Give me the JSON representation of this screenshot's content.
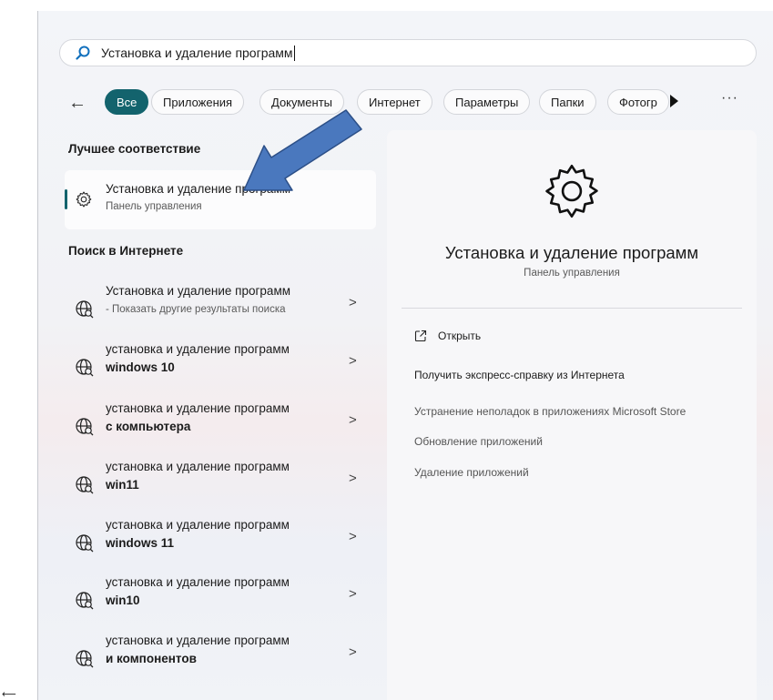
{
  "search": {
    "query": "Установка и удаление программ"
  },
  "filters": {
    "back_label": "←",
    "chips": [
      "Все",
      "Приложения",
      "Документы",
      "Интернет",
      "Параметры",
      "Папки",
      "Фотогр"
    ],
    "more_label": "···"
  },
  "best_match": {
    "heading": "Лучшее соответствие",
    "title": "Установка и удаление программ",
    "subtitle": "Панель управления"
  },
  "web": {
    "heading": "Поиск в Интернете",
    "items": [
      {
        "line1": "Установка и удаление программ",
        "line2": "- Показать другие результаты поиска"
      },
      {
        "line1": "установка и удаление программ",
        "line2": "windows 10"
      },
      {
        "line1": "установка и удаление программ",
        "line2": "с компьютера"
      },
      {
        "line1": "установка и удаление программ",
        "line2": "win11"
      },
      {
        "line1": "установка и удаление программ",
        "line2": "windows 11"
      },
      {
        "line1": "установка и удаление программ",
        "line2": "win10"
      },
      {
        "line1": "установка и удаление программ",
        "line2": "и компонентов"
      }
    ],
    "chevron": ">"
  },
  "detail": {
    "title": "Установка и удаление программ",
    "subtitle": "Панель управления",
    "open_label": "Открыть",
    "actions": [
      "Получить экспресс-справку из Интернета",
      "Устранение неполадок в приложениях Microsoft Store",
      "Обновление приложений",
      "Удаление приложений"
    ]
  },
  "colors": {
    "accent": "#13636d",
    "annotation_arrow": "#4a78be"
  },
  "icons": {
    "search": "search-icon",
    "settings": "gear-icon",
    "web": "web-search-icon",
    "open": "open-external-icon"
  }
}
